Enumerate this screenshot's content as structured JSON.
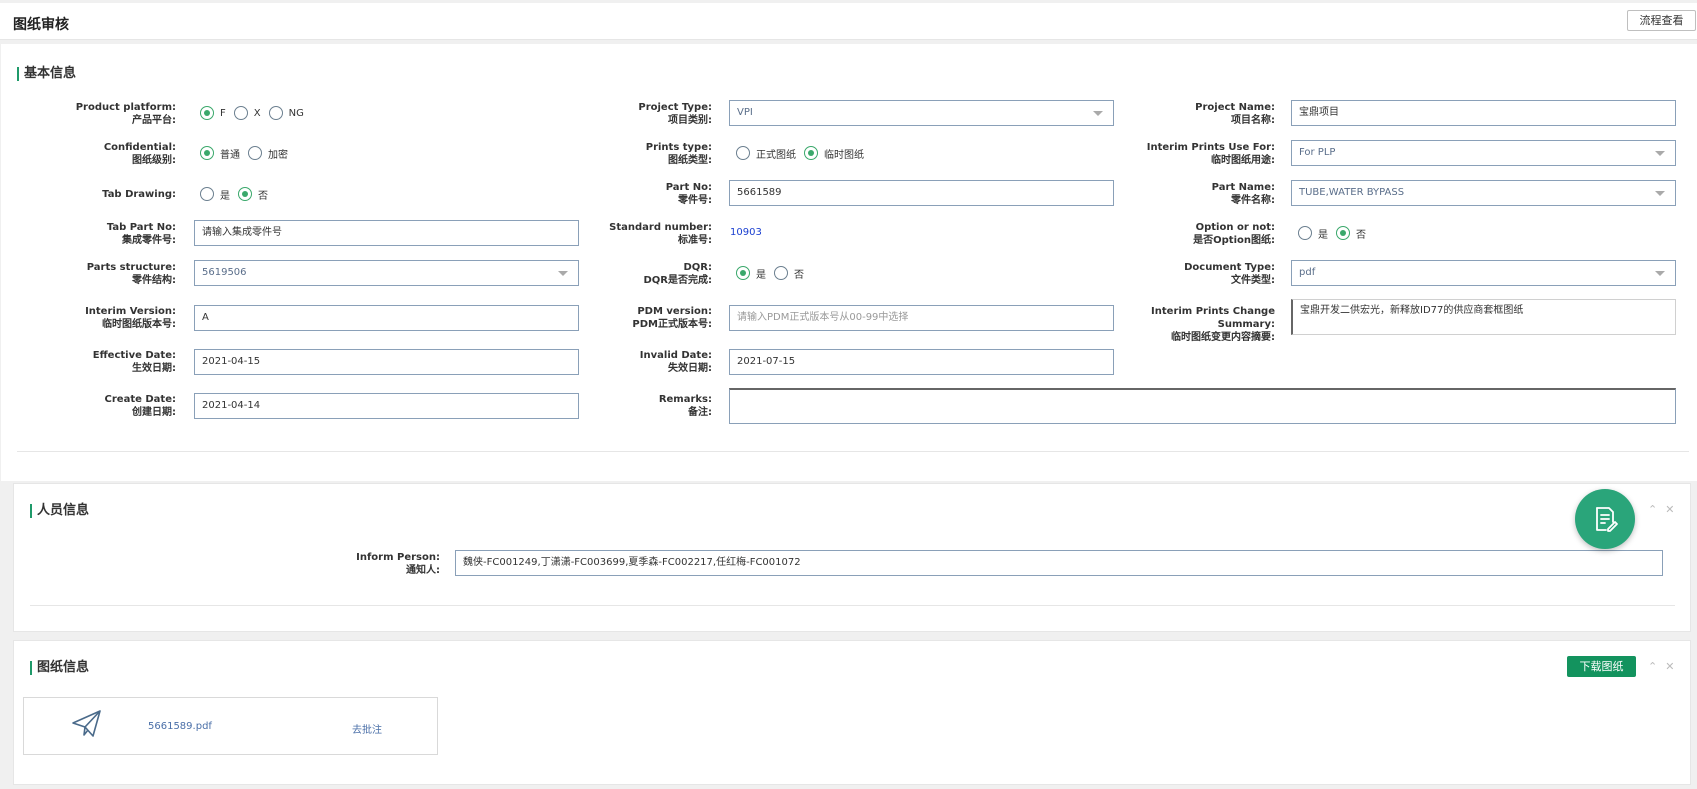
{
  "header": {
    "title": "图纸审核",
    "flow_button": "流程查看"
  },
  "basic": {
    "title": "基本信息",
    "product_platform": {
      "en": "Product platform:",
      "cn": "产品平台:",
      "options": [
        "F",
        "X",
        "NG"
      ],
      "selected": "F"
    },
    "confidential": {
      "en": "Confidential:",
      "cn": "图纸级别:",
      "options": [
        "普通",
        "加密"
      ],
      "selected": "普通"
    },
    "tab_drawing": {
      "en": "Tab Drawing:",
      "cn": "",
      "options": [
        "是",
        "否"
      ],
      "selected": "否"
    },
    "tab_part_no": {
      "en": "Tab Part No:",
      "cn": "集成零件号:",
      "value": "请输入集成零件号"
    },
    "parts_structure": {
      "en": "Parts structure:",
      "cn": "零件结构:",
      "value": "5619506"
    },
    "interim_version": {
      "en": "Interim Version:",
      "cn": "临时图纸版本号:",
      "value": "A"
    },
    "effective_date": {
      "en": "Effective Date:",
      "cn": "生效日期:",
      "value": "2021-04-15"
    },
    "create_date": {
      "en": "Create Date:",
      "cn": "创建日期:",
      "value": "2021-04-14"
    },
    "project_type": {
      "en": "Project Type:",
      "cn": "项目类别:",
      "value": "VPI"
    },
    "prints_type": {
      "en": "Prints type:",
      "cn": "图纸类型:",
      "options": [
        "正式图纸",
        "临时图纸"
      ],
      "selected": "临时图纸"
    },
    "part_no": {
      "en": "Part No:",
      "cn": "零件号:",
      "value": "5661589"
    },
    "standard_number": {
      "en": "Standard number:",
      "cn": "标准号:",
      "value": "10903"
    },
    "dqr": {
      "en": "DQR:",
      "cn": "DQR是否完成:",
      "options": [
        "是",
        "否"
      ],
      "selected": "是"
    },
    "pdm_version": {
      "en": "PDM version:",
      "cn": "PDM正式版本号:",
      "placeholder": "请输入PDM正式版本号从00-99中选择"
    },
    "invalid_date": {
      "en": "Invalid Date:",
      "cn": "失效日期:",
      "value": "2021-07-15"
    },
    "remarks": {
      "en": "Remarks:",
      "cn": "备注:",
      "value": ""
    },
    "project_name": {
      "en": "Project Name:",
      "cn": "项目名称:",
      "value": "宝鼎项目"
    },
    "interim_use": {
      "en": "Interim Prints Use For:",
      "cn": "临时图纸用途:",
      "value": "For PLP"
    },
    "part_name": {
      "en": "Part Name:",
      "cn": "零件名称:",
      "value": "TUBE,WATER BYPASS"
    },
    "option_or_not": {
      "en": "Option or not:",
      "cn": "是否Option图纸:",
      "options": [
        "是",
        "否"
      ],
      "selected": "否"
    },
    "document_type": {
      "en": "Document Type:",
      "cn": "文件类型:",
      "value": "pdf"
    },
    "change_summary": {
      "en": "Interim Prints Change Summary:",
      "cn": "临时图纸变更内容摘要:",
      "value": "宝鼎开发二供宏光，新释放ID77的供应商套框图纸"
    }
  },
  "personnel": {
    "title": "人员信息",
    "inform_person": {
      "en": "Inform Person:",
      "cn": "通知人:",
      "value": "魏侠-FC001249,丁潇潇-FC003699,夏季森-FC002217,任红梅-FC001072"
    }
  },
  "drawings": {
    "title": "图纸信息",
    "download_button": "下载图纸",
    "files": [
      {
        "name": "5661589.pdf",
        "action": "去批注"
      }
    ]
  },
  "colors": {
    "accent": "#1f9a6a",
    "radio_on": "#3aa86b",
    "download": "#13935e",
    "fab": "#2aa57a"
  },
  "icons": {
    "fab": "edit-document-icon",
    "file": "paper-plane-icon",
    "collapse": "chevron-up-icon",
    "close": "close-icon"
  }
}
